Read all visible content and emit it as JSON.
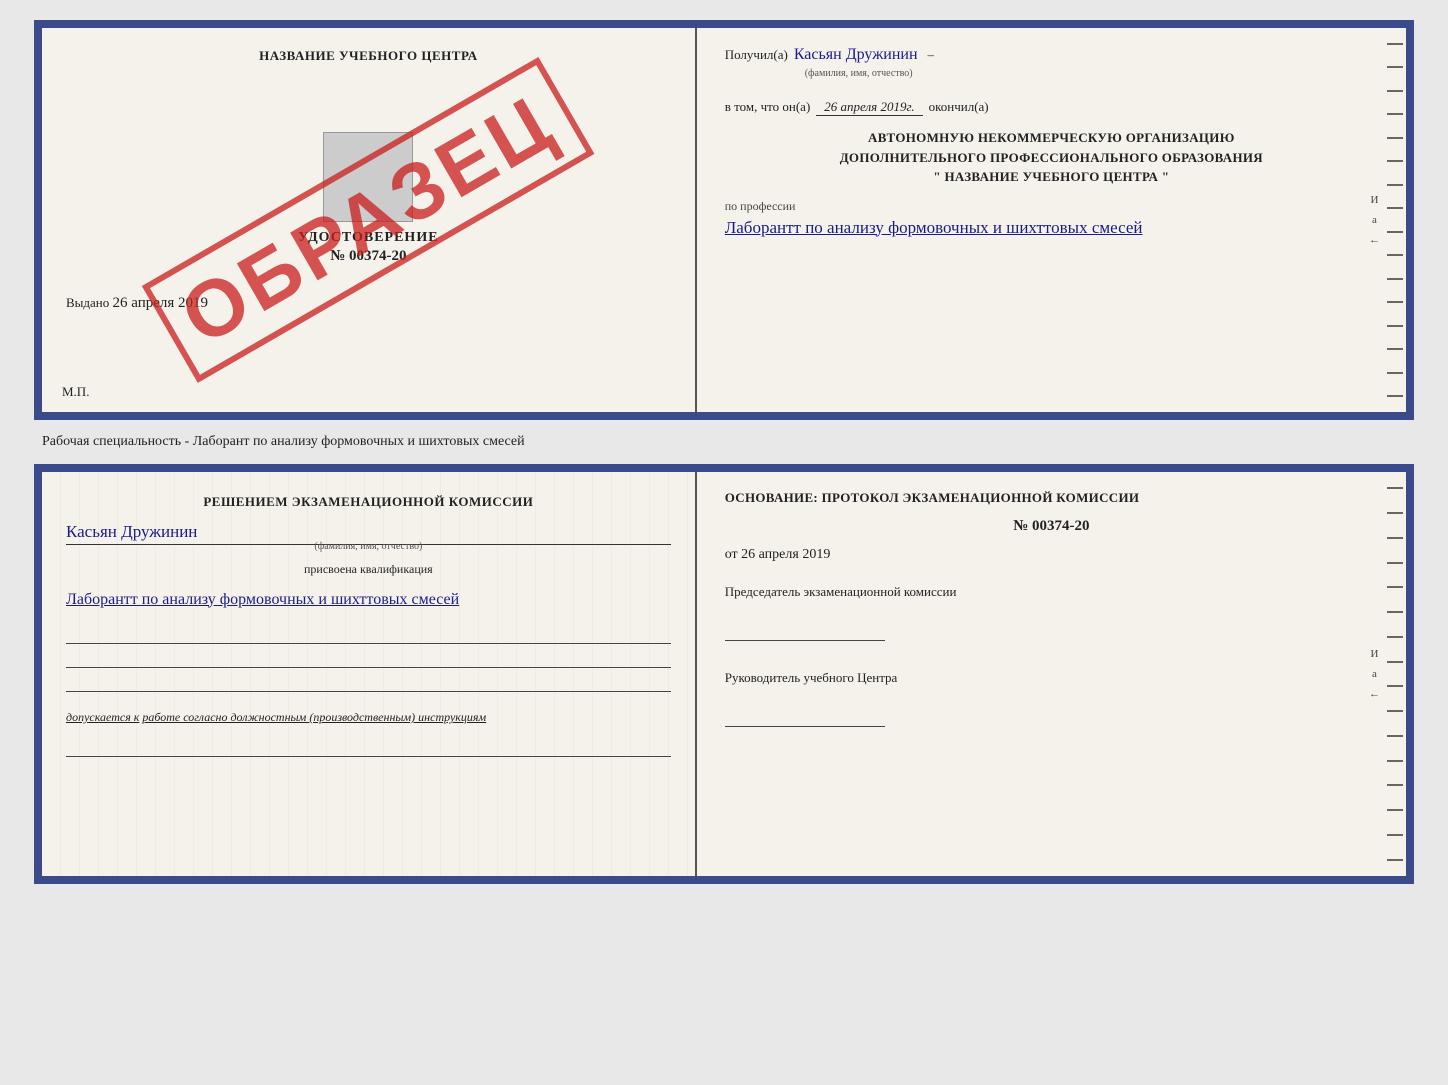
{
  "top": {
    "left": {
      "title": "НАЗВАНИЕ УЧЕБНОГО ЦЕНТРА",
      "stamp": "ОБРАЗЕЦ",
      "cert_label": "УДОСТОВЕРЕНИЕ",
      "cert_number": "№ 00374-20",
      "issued_label": "Выдано",
      "issued_date": "26 апреля 2019",
      "mp_label": "М.П."
    },
    "right": {
      "received_label": "Получил(а)",
      "received_name": "Касьян Дружинин",
      "name_hint": "(фамилия, имя, отчество)",
      "in_that_label": "в том, что он(а)",
      "date_value": "26 апреля 2019г.",
      "finished_label": "окончил(а)",
      "org_line1": "АВТОНОМНУЮ НЕКОММЕРЧЕСКУЮ ОРГАНИЗАЦИЮ",
      "org_line2": "ДОПОЛНИТЕЛЬНОГО ПРОФЕССИОНАЛЬНОГО ОБРАЗОВАНИЯ",
      "org_line3": "\"   НАЗВАНИЕ УЧЕБНОГО ЦЕНТРА   \"",
      "profession_label": "по профессии",
      "profession_handwritten": "Лаборантт по анализу формовочных и шихттовых смесей"
    }
  },
  "middle": {
    "label": "Рабочая специальность - Лаборант по анализу формовочных и шихтовых смесей"
  },
  "bottom": {
    "left": {
      "title": "Решением экзаменационной комиссии",
      "name": "Касьян Дружинин",
      "name_hint": "(фамилия, имя, отчество)",
      "qual_label": "присвоена квалификация",
      "qual_handwritten": "Лаборантт по анализу формовочных и шихттовых смесей",
      "допускается_label": "допускается к",
      "допускается_text": "работе согласно должностным (производственным) инструкциям"
    },
    "right": {
      "basis_label": "Основание: протокол экзаменационной комиссии",
      "number": "№ 00374-20",
      "date_prefix": "от",
      "date_value": "26 апреля 2019",
      "chairman_label": "Председатель экзаменационной комиссии",
      "head_label": "Руководитель учебного Центра"
    }
  }
}
